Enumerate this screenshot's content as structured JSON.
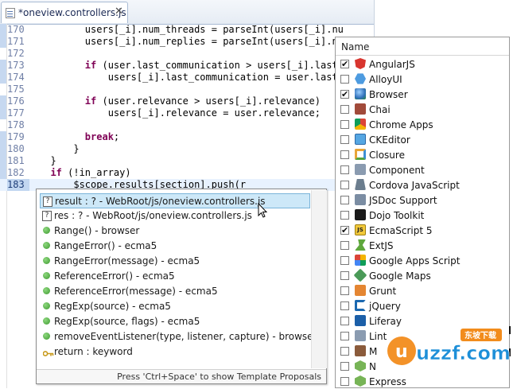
{
  "editor": {
    "tab_title": "*oneview.controllers.js",
    "tab_close": "✕",
    "lines": [
      {
        "num": "170",
        "text": "        users[_i].num_threads = parseInt(users[_i].nu"
      },
      {
        "num": "171",
        "text": "        users[_i].num_replies = parseInt(users[_i].nu"
      },
      {
        "num": "172",
        "text": ""
      },
      {
        "num": "173",
        "text": "        if (user.last_communication > users[_i].last_"
      },
      {
        "num": "174",
        "text": "            users[_i].last_communication = user.last_"
      },
      {
        "num": "175",
        "text": ""
      },
      {
        "num": "176",
        "text": "        if (user.relevance > users[_i].relevance)"
      },
      {
        "num": "177",
        "text": "            users[_i].relevance = user.relevance;"
      },
      {
        "num": "178",
        "text": ""
      },
      {
        "num": "179",
        "text": "        break;"
      },
      {
        "num": "180",
        "text": "      }"
      },
      {
        "num": "181",
        "text": "  }"
      },
      {
        "num": "182",
        "text": "  if (!in_array)"
      },
      {
        "num": "183",
        "text": "      $scope.results[section].push(r"
      }
    ]
  },
  "assist": {
    "proposals": [
      {
        "icon": "unknown-type-icon",
        "label": "result : ? - WebRoot/js/oneview.controllers.js",
        "selected": true
      },
      {
        "icon": "unknown-type-icon",
        "label": "res : ? - WebRoot/js/oneview.controllers.js",
        "selected": false
      },
      {
        "icon": "method-icon",
        "label": "Range() - browser"
      },
      {
        "icon": "method-icon",
        "label": "RangeError() - ecma5"
      },
      {
        "icon": "method-icon",
        "label": "RangeError(message) - ecma5"
      },
      {
        "icon": "method-icon",
        "label": "ReferenceError() - ecma5"
      },
      {
        "icon": "method-icon",
        "label": "ReferenceError(message) - ecma5"
      },
      {
        "icon": "method-icon",
        "label": "RegExp(source) - ecma5"
      },
      {
        "icon": "method-icon",
        "label": "RegExp(source, flags) - ecma5"
      },
      {
        "icon": "method-icon",
        "label": "removeEventListener(type, listener, capture) - browser"
      },
      {
        "icon": "keyword-icon",
        "label": "return : keyword"
      }
    ],
    "footer": "Press 'Ctrl+Space' to show Template Proposals",
    "unknown_glyph": "?"
  },
  "libraries": {
    "header": "Name",
    "check_glyph": "✔",
    "items": [
      {
        "name": "AngularJS",
        "checked": true,
        "icon": "angularjs-icon"
      },
      {
        "name": "AlloyUI",
        "checked": false,
        "icon": "alloyui-icon"
      },
      {
        "name": "Browser",
        "checked": true,
        "icon": "browser-globe-icon"
      },
      {
        "name": "Chai",
        "checked": false,
        "icon": "chai-icon"
      },
      {
        "name": "Chrome Apps",
        "checked": false,
        "icon": "chrome-icon"
      },
      {
        "name": "CKEditor",
        "checked": false,
        "icon": "ckeditor-icon"
      },
      {
        "name": "Closure",
        "checked": false,
        "icon": "closure-icon"
      },
      {
        "name": "Component",
        "checked": false,
        "icon": "component-icon"
      },
      {
        "name": "Cordova JavaScript",
        "checked": false,
        "icon": "cordova-icon"
      },
      {
        "name": "JSDoc Support",
        "checked": false,
        "icon": "jsdoc-icon"
      },
      {
        "name": "Dojo Toolkit",
        "checked": false,
        "icon": "dojo-icon"
      },
      {
        "name": "EcmaScript 5",
        "checked": true,
        "icon": "ecmascript-icon"
      },
      {
        "name": "ExtJS",
        "checked": false,
        "icon": "extjs-icon"
      },
      {
        "name": "Google Apps Script",
        "checked": false,
        "icon": "google-apps-icon"
      },
      {
        "name": "Google Maps",
        "checked": false,
        "icon": "google-maps-icon"
      },
      {
        "name": "Grunt",
        "checked": false,
        "icon": "grunt-icon"
      },
      {
        "name": "jQuery",
        "checked": false,
        "icon": "jquery-icon"
      },
      {
        "name": "Liferay",
        "checked": false,
        "icon": "liferay-icon"
      },
      {
        "name": "Lint",
        "checked": false,
        "icon": "lint-icon"
      },
      {
        "name": "M",
        "checked": false,
        "icon": "mocha-icon"
      },
      {
        "name": "N",
        "checked": false,
        "icon": "node-icon"
      },
      {
        "name": "Express",
        "checked": false,
        "icon": "express-icon"
      }
    ],
    "es5_badge": "JS"
  },
  "watermark": {
    "text": "uzzf.com",
    "sub": "东坡下载"
  },
  "colors": {
    "keyword": "#7f0055",
    "selection": "#cde8f8",
    "current_line": "#e8f2fe"
  }
}
